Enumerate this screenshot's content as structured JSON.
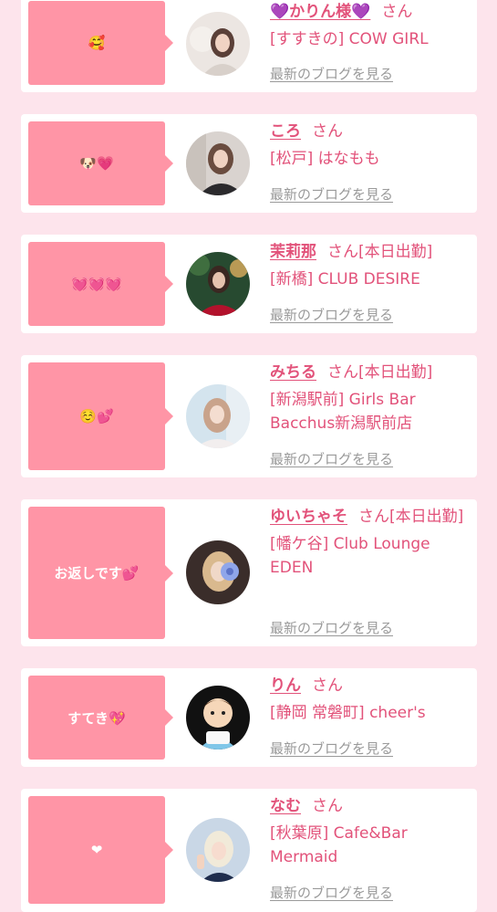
{
  "blog_link_label": "最新のブログを見る",
  "colors": {
    "page_background": "#fde4ec",
    "bubble": "#ff95a6",
    "accent_text": "#e2527a",
    "link_gray": "#9a9a9a",
    "card": "#ffffff"
  },
  "cards": [
    {
      "message": "🥰",
      "name": "💜かりん様💜",
      "suffix": "さん",
      "shop": "[すすきの] COW GIRL",
      "avatar_icon": "avatar-photo-icon"
    },
    {
      "message": "🐶💗",
      "name": "ころ",
      "suffix": "さん",
      "shop": "[松戸] はなもも",
      "avatar_icon": "avatar-photo-icon"
    },
    {
      "message": "💓💓💓",
      "name": "茉莉那",
      "suffix": "さん[本日出勤]",
      "shop": "[新橋] CLUB DESIRE",
      "avatar_icon": "avatar-photo-icon"
    },
    {
      "message": "☺️💕",
      "name": "みちる",
      "suffix": "さん[本日出勤]",
      "shop": "[新潟駅前] Girls Bar Bacchus新潟駅前店",
      "avatar_icon": "avatar-photo-icon"
    },
    {
      "message": "お返しです💕",
      "name": "ゆいちゃそ",
      "suffix": "さん[本日出勤]",
      "shop": "[幡ケ谷] Club Lounge EDEN",
      "avatar_icon": "avatar-photo-icon"
    },
    {
      "message": "すてき💖",
      "name": "りん",
      "suffix": "さん",
      "shop": "[静岡 常磐町] cheer's",
      "avatar_icon": "avatar-illustration-icon"
    },
    {
      "message": "❤",
      "name": "なむ",
      "suffix": "さん",
      "shop": "[秋葉原] Cafe&Bar Mermaid",
      "avatar_icon": "avatar-photo-icon"
    }
  ]
}
